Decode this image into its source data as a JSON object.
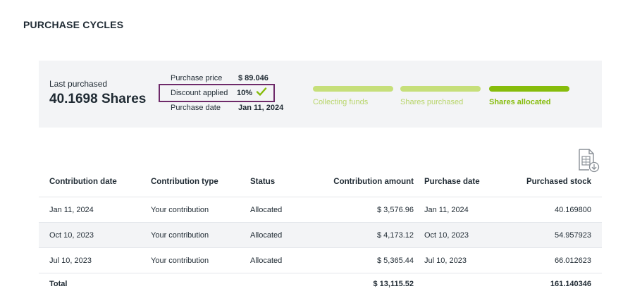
{
  "page": {
    "title": "PURCHASE CYCLES"
  },
  "summary": {
    "last_purchased_label": "Last purchased",
    "last_purchased_value": "40.1698 Shares",
    "purchase_price_label": "Purchase price",
    "purchase_price_value": "$ 89.046",
    "discount_label": "Discount applied",
    "discount_value": "10%",
    "discount_icon": "checkmark-icon",
    "purchase_date_label": "Purchase date",
    "purchase_date_value": "Jan 11, 2024"
  },
  "stages": [
    {
      "label": "Collecting funds",
      "state": "complete"
    },
    {
      "label": "Shares purchased",
      "state": "complete"
    },
    {
      "label": "Shares allocated",
      "state": "current"
    }
  ],
  "colors": {
    "accent": "#86bc0b",
    "accent_light": "#c6df7a",
    "highlight_border": "#6e2a6a",
    "card_bg": "#f3f4f6"
  },
  "export_icon": "export-spreadsheet-icon",
  "table": {
    "headers": [
      "Contribution date",
      "Contribution type",
      "Status",
      "Contribution amount",
      "Purchase date",
      "Purchased stock"
    ],
    "rows": [
      [
        "Jan 11, 2024",
        "Your contribution",
        "Allocated",
        "$ 3,576.96",
        "Jan 11, 2024",
        "40.169800"
      ],
      [
        "Oct 10, 2023",
        "Your contribution",
        "Allocated",
        "$ 4,173.12",
        "Oct 10, 2023",
        "54.957923"
      ],
      [
        "Jul 10, 2023",
        "Your contribution",
        "Allocated",
        "$ 5,365.44",
        "Jul 10, 2023",
        "66.012623"
      ]
    ],
    "total": {
      "label": "Total",
      "amount": "$ 13,115.52",
      "stock": "161.140346"
    }
  }
}
